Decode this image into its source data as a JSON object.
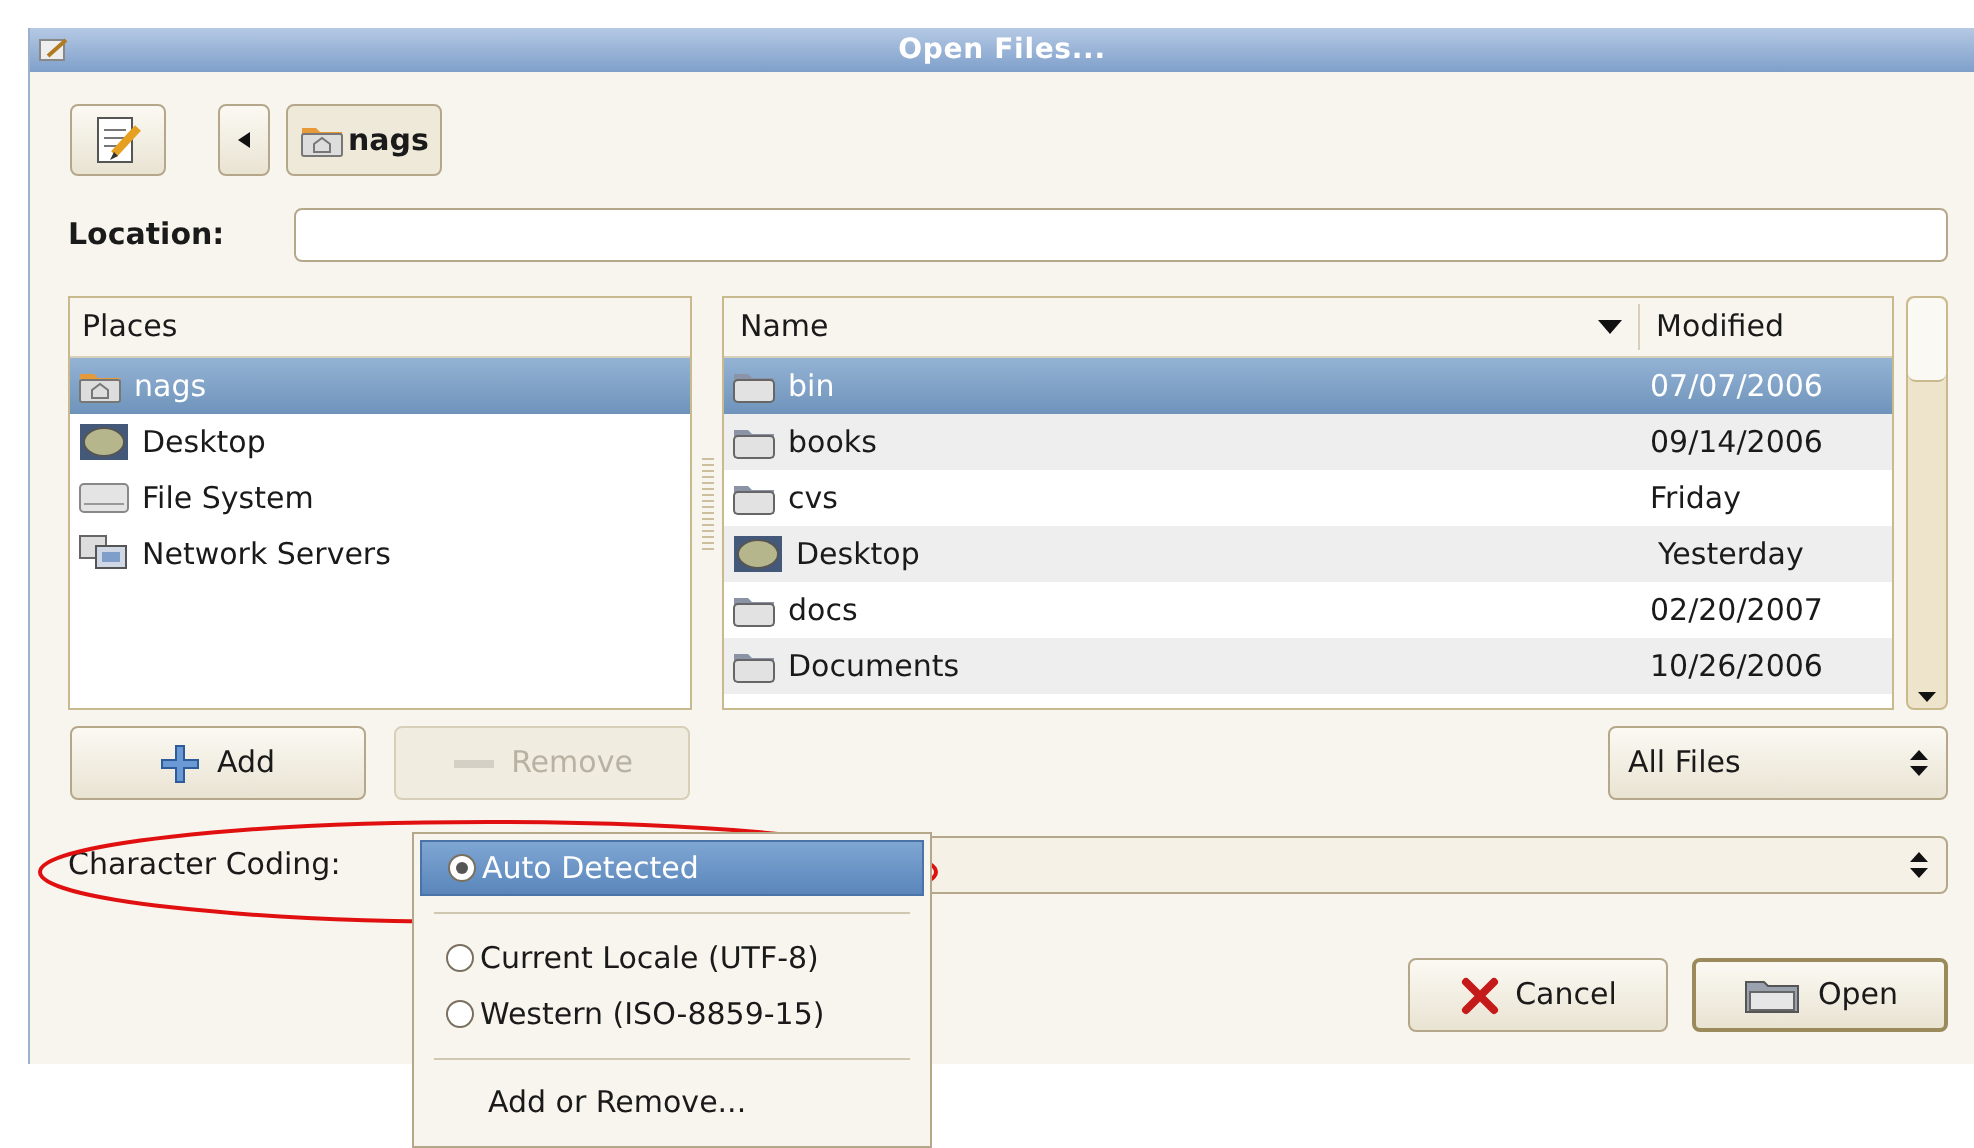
{
  "window": {
    "title": "Open Files..."
  },
  "path_bar": {
    "buttons": [
      {
        "label": "nags",
        "selected": true
      }
    ]
  },
  "location": {
    "label": "Location:"
  },
  "places": {
    "header": "Places",
    "items": [
      {
        "label": "nags",
        "kind": "home",
        "selected": true
      },
      {
        "label": "Desktop",
        "kind": "desktop",
        "selected": false
      },
      {
        "label": "File System",
        "kind": "drive",
        "selected": false
      },
      {
        "label": "Network Servers",
        "kind": "network",
        "selected": false
      }
    ]
  },
  "files": {
    "columns": [
      "Name",
      "Modified"
    ],
    "rows": [
      {
        "name": "bin",
        "modified": "07/07/2006",
        "kind": "folder",
        "selected": true
      },
      {
        "name": "books",
        "modified": "09/14/2006",
        "kind": "folder",
        "selected": false
      },
      {
        "name": "cvs",
        "modified": "Friday",
        "kind": "folder",
        "selected": false
      },
      {
        "name": "Desktop",
        "modified": "Yesterday",
        "kind": "desktop",
        "selected": false
      },
      {
        "name": "docs",
        "modified": "02/20/2007",
        "kind": "folder",
        "selected": false
      },
      {
        "name": "Documents",
        "modified": "10/26/2006",
        "kind": "folder",
        "selected": false
      }
    ]
  },
  "place_buttons": [
    {
      "label": "Add",
      "kind": "add",
      "disabled": false
    },
    {
      "label": "Remove",
      "kind": "remove",
      "disabled": true
    }
  ],
  "filter": {
    "value": "All Files"
  },
  "character_coding": {
    "label": "Character Coding:",
    "menu": [
      {
        "kind": "radio",
        "label": "Auto Detected",
        "selected": true
      },
      {
        "kind": "separator"
      },
      {
        "kind": "radio",
        "label": "Current Locale (UTF-8)",
        "selected": false
      },
      {
        "kind": "radio",
        "label": "Western (ISO-8859-15)",
        "selected": false
      },
      {
        "kind": "separator"
      },
      {
        "kind": "action",
        "label": "Add or Remove..."
      }
    ]
  },
  "dialog_buttons": [
    {
      "label": "Cancel",
      "kind": "cancel",
      "default": false
    },
    {
      "label": "Open",
      "kind": "open",
      "default": true
    }
  ]
}
